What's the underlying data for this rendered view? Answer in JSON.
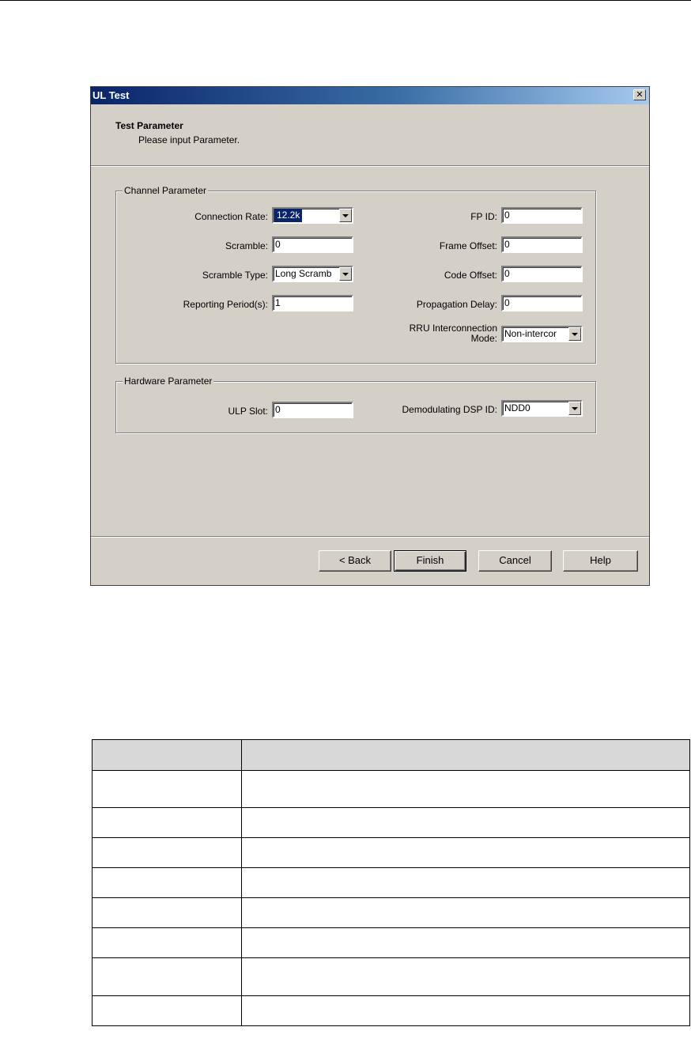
{
  "dialog": {
    "title": "UL Test",
    "close_symbol": "✕",
    "header_title": "Test Parameter",
    "header_subtitle": "Please input Parameter."
  },
  "channel_group": {
    "legend": "Channel Parameter",
    "connection_rate": {
      "label": "Connection Rate:",
      "value": "12.2k"
    },
    "scramble": {
      "label": "Scramble:",
      "value": "0"
    },
    "scramble_type": {
      "label": "Scramble Type:",
      "value": "Long Scramb"
    },
    "reporting_period": {
      "label": "Reporting Period(s):",
      "value": "1"
    },
    "fp_id": {
      "label": "FP ID:",
      "value": "0"
    },
    "frame_offset": {
      "label": "Frame Offset:",
      "value": "0"
    },
    "code_offset": {
      "label": "Code Offset:",
      "value": "0"
    },
    "propagation_delay": {
      "label": "Propagation Delay:",
      "value": "0"
    },
    "rru_mode": {
      "label": "RRU Interconnection Mode:",
      "value": "Non-intercor"
    }
  },
  "hardware_group": {
    "legend": "Hardware Parameter",
    "ulp_slot": {
      "label": "ULP Slot:",
      "value": "0"
    },
    "dsp_id": {
      "label": "Demodulating DSP ID:",
      "value": "NDD0"
    }
  },
  "buttons": {
    "back": "< Back",
    "finish": "Finish",
    "cancel": "Cancel",
    "help": "Help"
  },
  "colors": {
    "dialog_face": "#d4d0c8",
    "title_gradient_start": "#0a246a",
    "title_gradient_end": "#a6caf0",
    "selection": "#0a246a",
    "table_header": "#d8d8d8"
  }
}
